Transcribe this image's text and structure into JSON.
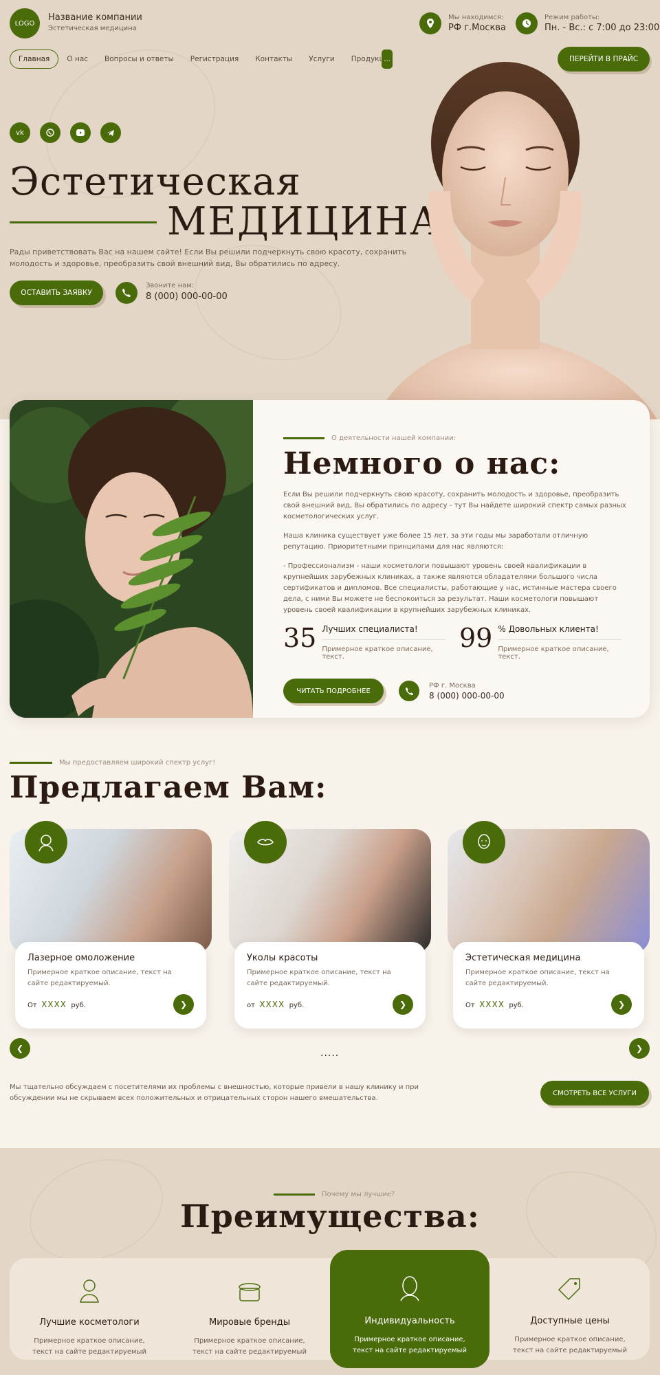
{
  "header": {
    "logo": "LOGO",
    "company_name": "Название компании",
    "company_sub": "Эстетическая медицина",
    "location_label": "Мы находимся:",
    "location_value": "РФ г.Москва",
    "hours_label": "Режим работы:",
    "hours_value": "Пн. - Вс.: с 7:00 до 23:00",
    "nav": [
      "Главная",
      "О нас",
      "Вопросы и ответы",
      "Регистрация",
      "Контакты",
      "Услуги",
      "Продукция"
    ],
    "more": "...",
    "price_button": "ПЕРЕЙТИ В ПРАЙС"
  },
  "hero": {
    "socials": [
      "vk",
      "wa",
      "yt",
      "tg"
    ],
    "title_line1": "Эстетическая",
    "title_line2": "МЕДИЦИНА",
    "intro": "Рады приветствовать Вас на нашем сайте! Если Вы решили подчеркнуть свою красоту, сохранить молодость и здоровье, преобразить свой внешний вид, Вы обратились по адресу.",
    "request_button": "ОСТАВИТЬ ЗАЯВКУ",
    "call_label": "Звоните нам:",
    "call_phone": "8 (000) 000-00-00"
  },
  "about": {
    "kicker": "О деятельности нашей компании:",
    "title": "Немного о нас:",
    "p1": "Если Вы решили подчеркнуть свою красоту, сохранить молодость и здоровье, преобразить свой внешний вид, Вы обратились по адресу - тут Вы найдете широкий спектр самых разных косметологических услуг.",
    "p2": "Наша клиника существует уже более 15 лет, за эти годы мы заработали отличную репутацию. Приоритетными принципами для нас являются:",
    "p3": "- Профессионализм - наши косметологи повышают уровень своей квалификации в крупнейших зарубежных клиниках, а также являются обладателями большого числа сертификатов и дипломов. Все специалисты, работающие у нас, истинные мастера своего дела, с ними Вы можете не беспокоиться за результат. Наши косметологи повышают уровень своей квалификации в крупнейших зарубежных клиниках.",
    "stats": [
      {
        "num": "35",
        "title": "Лучших специалиста!",
        "desc": "Примерное краткое описание, текст."
      },
      {
        "num": "99",
        "title": "% Довольных клиента!",
        "desc": "Примерное краткое описание, текст."
      }
    ],
    "more_button": "ЧИТАТЬ ПОДРОБНЕЕ",
    "address": "РФ г. Москва",
    "phone": "8 (000) 000-00-00"
  },
  "services": {
    "kicker": "Мы предоставляем широкий спектр услуг!",
    "title": "Предлагаем Вам:",
    "cards": [
      {
        "title": "Лазерное омоложение",
        "desc": "Примерное краткое описание, текст на сайте редактируемый.",
        "price_prefix": "От",
        "price": "XXXX",
        "price_suffix": "руб."
      },
      {
        "title": "Уколы красоты",
        "desc": "Примерное краткое описание, текст на сайте редактируемый.",
        "price_prefix": "от",
        "price": "XXXX",
        "price_suffix": "руб."
      },
      {
        "title": "Эстетическая медицина",
        "desc": "Примерное краткое описание, текст на сайте редактируемый.",
        "price_prefix": "От",
        "price": "XXXX",
        "price_suffix": "руб."
      }
    ],
    "pager": ".....",
    "note": "Мы тщательно обсуждаем с посетителями их проблемы с внешностью, которые привели в нашу клинику и при обсуждении мы не скрываем всех положительных и отрицательных сторон нашего вмешательства.",
    "all_button": "СМОТРЕТЬ ВСЕ УСЛУГИ"
  },
  "advantages": {
    "kicker": "Почему мы лучшие?",
    "title": "Преимущества:",
    "items": [
      {
        "title": "Лучшие косметологи",
        "desc": "Примерное краткое описание, текст на сайте редактируемый",
        "icon": "cosmetologist-icon"
      },
      {
        "title": "Мировые бренды",
        "desc": "Примерное краткое описание, текст на сайте редактируемый",
        "icon": "cream-jar-icon"
      },
      {
        "title": "Индивидуальность",
        "desc": "Примерное краткое описание, текст на сайте редактируемый",
        "icon": "face-icon"
      },
      {
        "title": "Доступные цены",
        "desc": "Примерное краткое описание, текст на сайте редактируемый",
        "icon": "price-tag-icon"
      }
    ]
  },
  "colors": {
    "accent": "#4a6b0a",
    "hero_bg": "#e4d6c6",
    "page_bg": "#f7f2ea"
  }
}
